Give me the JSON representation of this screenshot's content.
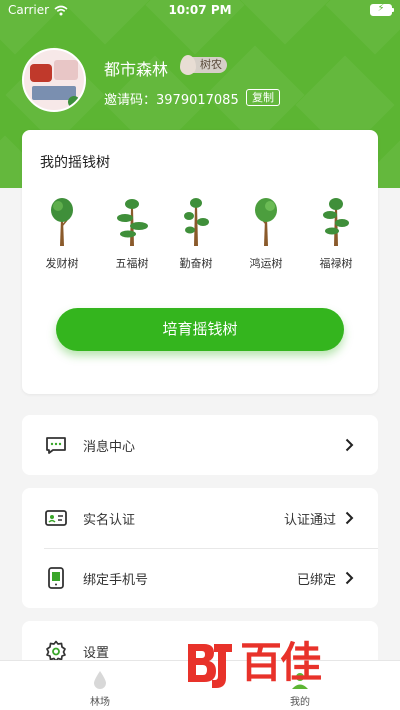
{
  "status_bar": {
    "carrier": "Carrier",
    "time": "10:07 PM",
    "battery_icon": "battery-charging-icon",
    "wifi_icon": "wifi-icon"
  },
  "profile": {
    "username": "都市森林",
    "badge": "树农",
    "invite_label": "邀请码：",
    "invite_code": "3979017085",
    "copy_label": "复制"
  },
  "tree_card": {
    "title": "我的摇钱树",
    "trees": [
      {
        "name": "发财树",
        "icon": "round-tree-icon"
      },
      {
        "name": "五福树",
        "icon": "bonsai-tree-icon"
      },
      {
        "name": "勤奋树",
        "icon": "topiary-tree-icon"
      },
      {
        "name": "鸿运树",
        "icon": "round-tree-icon"
      },
      {
        "name": "福禄树",
        "icon": "pine-tree-icon"
      }
    ],
    "button_label": "培育摇钱树"
  },
  "menu": {
    "messages": {
      "label": "消息中心",
      "icon": "message-bubble-icon"
    },
    "realname": {
      "label": "实名认证",
      "value": "认证通过",
      "icon": "id-card-icon"
    },
    "phone": {
      "label": "绑定手机号",
      "value": "已绑定",
      "icon": "phone-icon"
    },
    "settings": {
      "label": "设置",
      "icon": "gear-icon"
    }
  },
  "tabs": [
    {
      "label": "林场",
      "icon": "water-drop-icon",
      "active": false
    },
    {
      "label": "我的",
      "icon": "user-icon",
      "active": true
    }
  ],
  "watermark": {
    "text": "百佳",
    "logo": "bj-logo"
  },
  "colors": {
    "brand_green": "#5cb533",
    "button_green": "#34b51e",
    "watermark_red": "#e8322a"
  }
}
